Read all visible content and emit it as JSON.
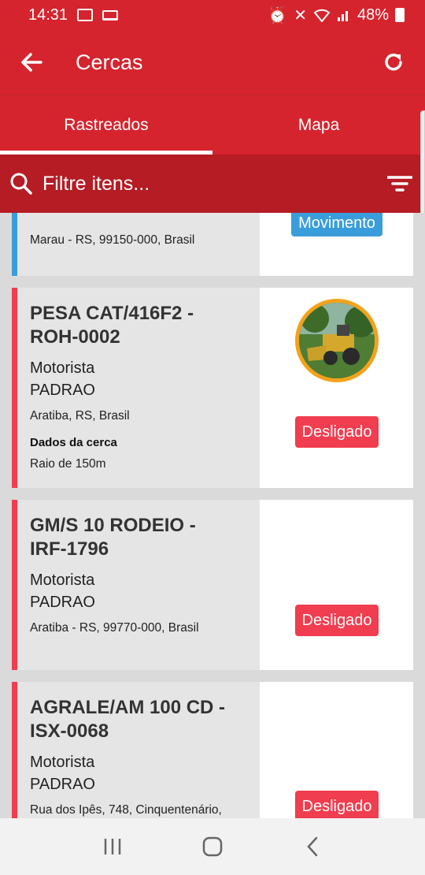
{
  "status": {
    "time": "14:31",
    "battery": "48%"
  },
  "appbar": {
    "title": "Cercas"
  },
  "tabs": [
    {
      "label": "Rastreados"
    },
    {
      "label": "Mapa"
    }
  ],
  "search": {
    "placeholder": "Filtre itens..."
  },
  "cards": [
    {
      "address": "Marau - RS, 99150-000, Brasil",
      "badge": "Movimento"
    },
    {
      "name_line1": "PESA CAT/416F2 -",
      "name_line2": "ROH-0002",
      "role": "Motorista",
      "driver": "PADRAO",
      "address": "Aratiba, RS, Brasil",
      "fence_title": "Dados da cerca",
      "fence_radius": "Raio de 150m",
      "badge": "Desligado"
    },
    {
      "name_line1": "GM/S 10 RODEIO -",
      "name_line2": "IRF-1796",
      "role": "Motorista",
      "driver": "PADRAO",
      "address": "Aratiba - RS, 99770-000, Brasil",
      "badge": "Desligado"
    },
    {
      "name_line1": "AGRALE/AM 100 CD -",
      "name_line2": "ISX-0068",
      "role": "Motorista",
      "driver": "PADRAO",
      "address": "Rua dos Ipês, 748, Cinquentenário,",
      "badge": "Desligado"
    }
  ],
  "colors": {
    "primary": "#d5242e",
    "primary_dark": "#b51c24",
    "off": "#f03d4f",
    "moving": "#3a9ddb",
    "avatar_ring": "#f3a21b"
  }
}
